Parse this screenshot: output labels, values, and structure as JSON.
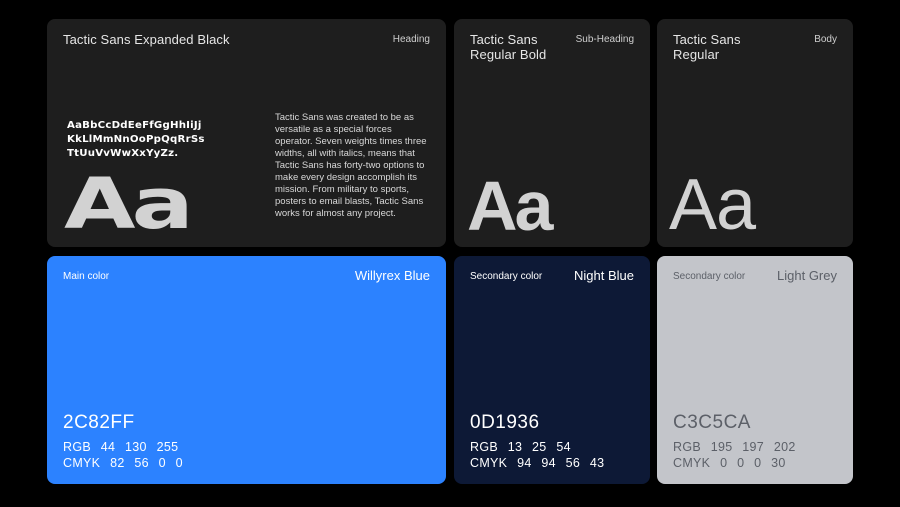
{
  "typography": [
    {
      "title": "Tactic Sans Expanded Black",
      "role": "Heading",
      "alphabet": "AaBbCcDdEeFfGgHhIiJj\nKkLlMmNnOoPpQqRrSs\nTtUuVvWwXxYyZz.",
      "description": "Tactic Sans was created to be as versatile as a special forces operator. Seven weights times three widths, all with italics, means that Tactic Sans has forty-two options to make every design accomplish its mission. From military to sports, posters to email blasts, Tactic Sans works for almost any project.",
      "sample": "Aa"
    },
    {
      "title": "Tactic Sans\nRegular Bold",
      "role": "Sub-Heading",
      "sample": "Aa"
    },
    {
      "title": "Tactic Sans\nRegular",
      "role": "Body",
      "sample": "Aa"
    }
  ],
  "colors": [
    {
      "label": "Main color",
      "name": "Willyrex Blue",
      "hex": "2C82FF",
      "rgb": "RGB 44 130 255",
      "cmyk": "CMYK 82 56 0 0",
      "background": "#2c82ff",
      "text_color": "#ffffff"
    },
    {
      "label": "Secondary color",
      "name": "Night Blue",
      "hex": "0D1936",
      "rgb": "RGB 13 25 54",
      "cmyk": "CMYK 94 94 56 43",
      "background": "#0d1936",
      "text_color": "#ffffff"
    },
    {
      "label": "Secondary color",
      "name": "Light Grey",
      "hex": "C3C5CA",
      "rgb": "RGB 195 197 202",
      "cmyk": "CMYK 0 0 0 30",
      "background": "#c3c5ca",
      "text_color": "#5c6068"
    }
  ]
}
